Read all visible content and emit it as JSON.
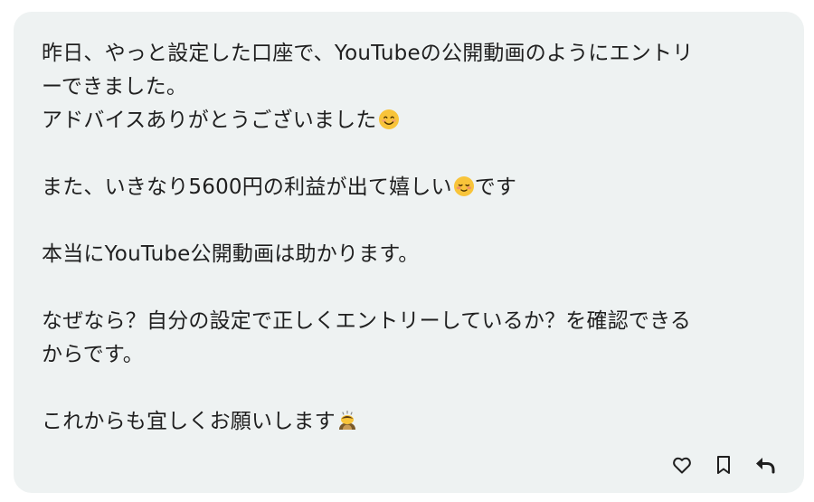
{
  "message": {
    "line1": "昨日、やっと設定した口座で、YouTubeの公開動画のようにエントリ",
    "line2": "ーできました。",
    "line3": "アドバイスありがとうございました",
    "line3_emoji": "smiling-face-icon",
    "line4a": "また、いきなり5600円の利益が出て嬉しい",
    "line4_emoji": "relieved-smile-icon",
    "line4b": "です",
    "line5": "本当にYouTube公開動画は助かります。",
    "line6": "なぜなら？自分の設定で正しくエントリーしているか？を確認できる",
    "line7": "からです。",
    "line8": "これからも宜しくお願いします",
    "line8_emoji": "bowing-person-icon"
  },
  "actions": {
    "like_icon": "heart-icon",
    "bookmark_icon": "bookmark-icon",
    "reply_icon": "reply-icon"
  },
  "colors": {
    "card_background": "#eef2f2",
    "text": "#1f1f1f",
    "emoji_yellow": "#f8c43a"
  }
}
